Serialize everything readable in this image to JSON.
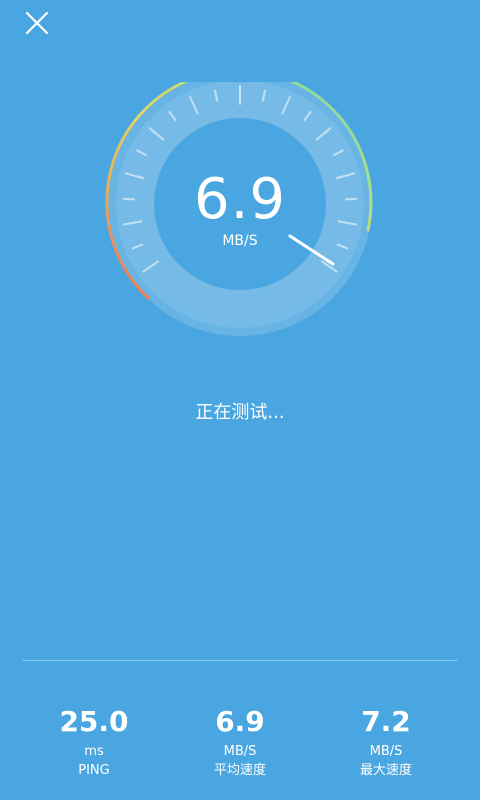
{
  "header": {
    "close_icon": "close-icon"
  },
  "gauge": {
    "value": "6.9",
    "unit": "MB/S"
  },
  "status": {
    "text": "正在测试..."
  },
  "stats": [
    {
      "value": "25.0",
      "unit": "ms",
      "label": "PING"
    },
    {
      "value": "6.9",
      "unit": "MB/S",
      "label": "平均速度"
    },
    {
      "value": "7.2",
      "unit": "MB/S",
      "label": "最大速度"
    }
  ],
  "colors": {
    "background": "#4aa6e0",
    "arc_green": "#9fe08a",
    "arc_yellow": "#e6d36a",
    "arc_red": "#f06b5a"
  }
}
